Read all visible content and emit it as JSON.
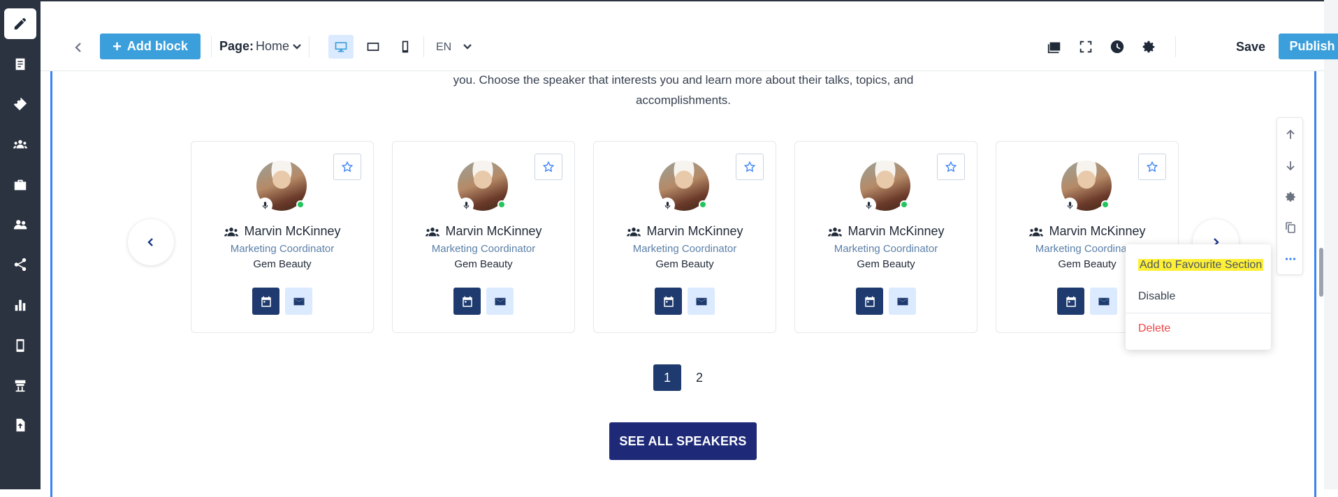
{
  "sidebar": {
    "items": [
      {
        "icon": "pencil-icon",
        "active": true
      },
      {
        "icon": "document-list-icon"
      },
      {
        "icon": "ticket-icon"
      },
      {
        "icon": "group-icon"
      },
      {
        "icon": "briefcase-icon"
      },
      {
        "icon": "users-icon"
      },
      {
        "icon": "share-icon"
      },
      {
        "icon": "bar-chart-icon"
      },
      {
        "icon": "mobile-icon"
      },
      {
        "icon": "booth-icon"
      },
      {
        "icon": "file-upload-icon"
      }
    ]
  },
  "toolbar": {
    "add_block_label": "Add block",
    "page_label": "Page:",
    "page_value": "Home",
    "language": "EN",
    "save_label": "Save",
    "publish_label": "Publish"
  },
  "section": {
    "intro_line1": "you. Choose the speaker that interests you and learn more about their talks, topics, and",
    "intro_line2": "accomplishments.",
    "speakers": [
      {
        "name": "Marvin McKinney",
        "role": "Marketing Coordinator",
        "company": "Gem Beauty"
      },
      {
        "name": "Marvin McKinney",
        "role": "Marketing Coordinator",
        "company": "Gem Beauty"
      },
      {
        "name": "Marvin McKinney",
        "role": "Marketing Coordinator",
        "company": "Gem Beauty"
      },
      {
        "name": "Marvin McKinney",
        "role": "Marketing Coordinator",
        "company": "Gem Beauty"
      },
      {
        "name": "Marvin McKinney",
        "role": "Marketing Coordinator",
        "company": "Gem Beauty"
      }
    ],
    "pages": [
      "1",
      "2"
    ],
    "active_page": "1",
    "see_all_label": "SEE ALL SPEAKERS"
  },
  "context_menu": {
    "items": [
      "Add to Favourite Section",
      "Disable",
      "Delete"
    ]
  },
  "colors": {
    "accent": "#3b9fdb",
    "navy": "#1e3a6e",
    "cta": "#1e2a78",
    "danger": "#ef4444",
    "highlight": "#fef037"
  }
}
